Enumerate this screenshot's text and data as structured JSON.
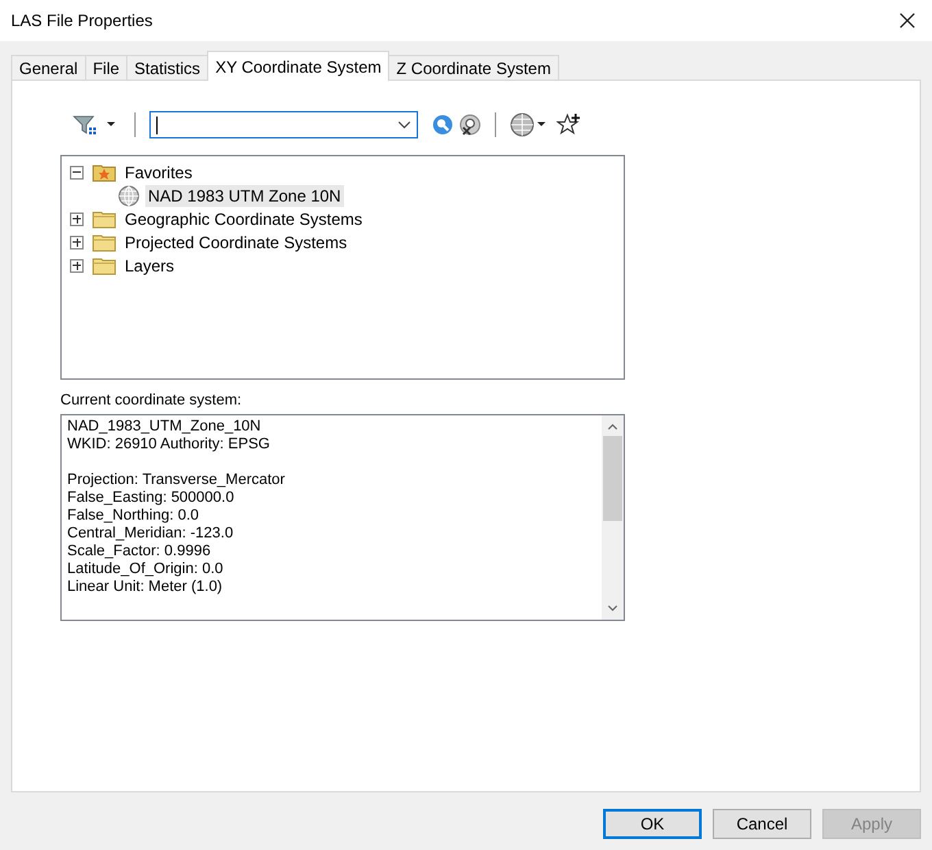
{
  "window": {
    "title": "LAS File Properties"
  },
  "tabs": [
    {
      "label": "General",
      "selected": false
    },
    {
      "label": "File",
      "selected": false
    },
    {
      "label": "Statistics",
      "selected": false
    },
    {
      "label": "XY Coordinate System",
      "selected": true
    },
    {
      "label": "Z Coordinate System",
      "selected": false
    }
  ],
  "tree": [
    {
      "label": "Favorites",
      "kind": "favorites",
      "expanded": true,
      "selected": false,
      "children": [
        {
          "label": "NAD 1983 UTM Zone 10N",
          "kind": "system",
          "selected": true
        }
      ]
    },
    {
      "label": "Geographic Coordinate Systems",
      "kind": "folder",
      "expanded": false,
      "selected": false
    },
    {
      "label": "Projected Coordinate Systems",
      "kind": "folder",
      "expanded": false,
      "selected": false
    },
    {
      "label": "Layers",
      "kind": "folder",
      "expanded": false,
      "selected": false
    }
  ],
  "current": {
    "label": "Current coordinate system:",
    "paragraphs": [
      [
        "NAD_1983_UTM_Zone_10N",
        "WKID: 26910 Authority: EPSG"
      ],
      [
        "Projection: Transverse_Mercator",
        "False_Easting: 500000.0",
        "False_Northing: 0.0",
        "Central_Meridian: -123.0",
        "Scale_Factor: 0.9996",
        "Latitude_Of_Origin: 0.0",
        "Linear Unit: Meter (1.0)"
      ]
    ]
  },
  "buttons": [
    {
      "label": "OK",
      "disabled": false,
      "default": true
    },
    {
      "label": "Cancel",
      "disabled": false,
      "default": false
    },
    {
      "label": "Apply",
      "disabled": true,
      "default": false
    }
  ]
}
